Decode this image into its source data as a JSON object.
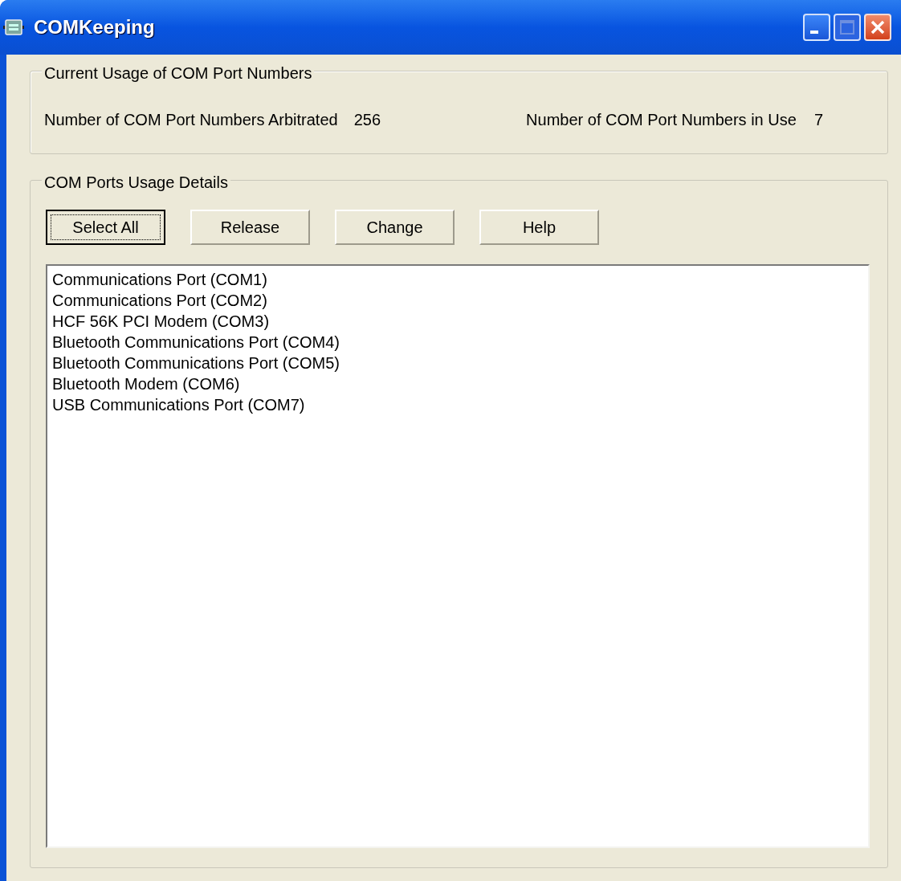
{
  "window": {
    "title": "COMKeeping",
    "controls": [
      {
        "kind": "minimize",
        "disabled": false
      },
      {
        "kind": "maximize",
        "disabled": true
      },
      {
        "kind": "close",
        "disabled": false
      }
    ]
  },
  "usage_group": {
    "title": "Current Usage of COM Port Numbers",
    "arbitrated_label": "Number of COM Port Numbers Arbitrated",
    "arbitrated_value": "256",
    "in_use_label": "Number of COM Port Numbers in Use",
    "in_use_value": "7"
  },
  "details_group": {
    "title": "COM Ports Usage Details",
    "buttons": [
      {
        "label": "Select All",
        "focused": true
      },
      {
        "label": "Release",
        "focused": false
      },
      {
        "label": "Change",
        "focused": false
      },
      {
        "label": "Help",
        "focused": false
      }
    ],
    "ports": [
      "Communications Port (COM1)",
      "Communications Port (COM2)",
      "HCF 56K PCI Modem (COM3)",
      "Bluetooth Communications Port (COM4)",
      "Bluetooth Communications Port (COM5)",
      "Bluetooth Modem (COM6)",
      "USB Communications Port (COM7)"
    ]
  }
}
